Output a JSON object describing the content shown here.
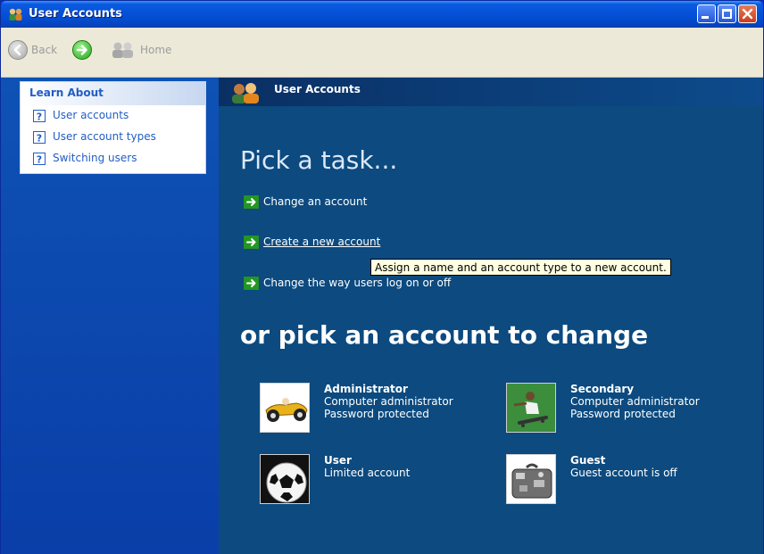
{
  "window": {
    "title": "User Accounts"
  },
  "toolbar": {
    "back_label": "Back",
    "home_label": "Home"
  },
  "learn_about": {
    "heading": "Learn About",
    "items": [
      {
        "label": "User accounts"
      },
      {
        "label": "User account types"
      },
      {
        "label": "Switching users"
      }
    ]
  },
  "main": {
    "header_title": "User Accounts",
    "pick_task": "Pick a task...",
    "tasks": [
      {
        "label": "Change an account"
      },
      {
        "label": "Create a new account"
      },
      {
        "label": "Change the way users log on or off"
      }
    ],
    "tooltip": "Assign a name and an account type to a new account.",
    "or_pick": "or pick an account to change",
    "accounts": [
      {
        "name": "Administrator",
        "lines": [
          "Computer administrator",
          "Password protected"
        ],
        "picture": "race-car-icon"
      },
      {
        "name": "Secondary",
        "lines": [
          "Computer administrator",
          "Password protected"
        ],
        "picture": "skateboarder-icon"
      },
      {
        "name": "User",
        "lines": [
          "Limited account"
        ],
        "picture": "soccer-ball-icon"
      },
      {
        "name": "Guest",
        "lines": [
          "Guest account is off"
        ],
        "picture": "suitcase-icon"
      }
    ]
  },
  "colors": {
    "titlebar": "#0550d8",
    "sidebar": "#0a3ea8",
    "main_panel": "#0c4a7f",
    "link": "#215dc6",
    "tooltip_bg": "#ffffe1"
  }
}
